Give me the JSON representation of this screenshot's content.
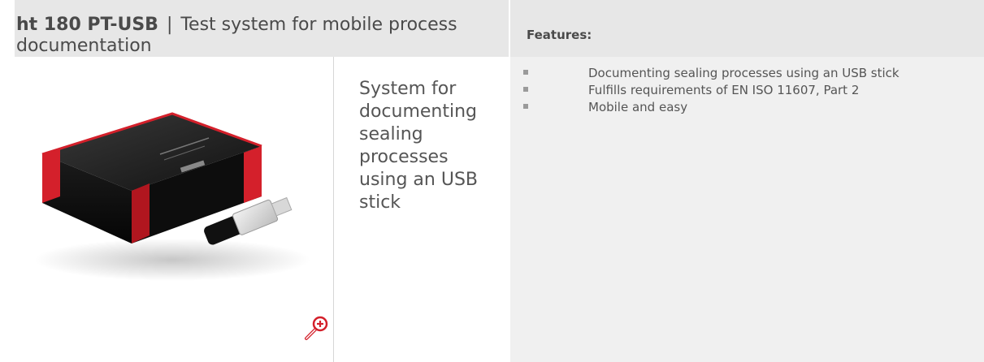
{
  "left_header": {
    "title_bold": "ht 180 PT-USB",
    "separator": "|",
    "title_rest": "Test system for mobile process documentation"
  },
  "right_header": {
    "label": "Features:"
  },
  "product": {
    "image_icon": "usb-test-device-image",
    "zoom_icon": "zoom-in-icon",
    "description": "System for documenting sealing processes using an USB stick"
  },
  "features": {
    "items": [
      {
        "label": "Documenting sealing processes using an USB stick"
      },
      {
        "label": "Fulfills requirements of EN ISO 11607, Part 2"
      },
      {
        "label": "Mobile and easy"
      }
    ]
  },
  "colors": {
    "header_bg": "#e7e7e7",
    "panel_bg": "#f0f0f0",
    "text": "#4a4a4a",
    "accent_red": "#d4202b"
  }
}
